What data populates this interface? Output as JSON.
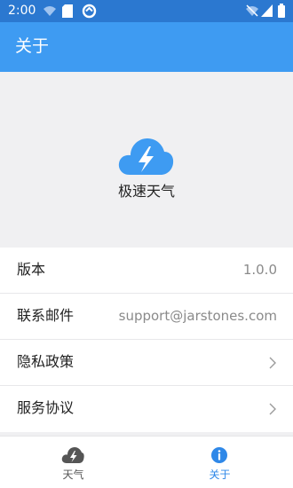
{
  "status_bar": {
    "time": "2:00"
  },
  "app_bar": {
    "title": "关于"
  },
  "about": {
    "app_name": "极速天气"
  },
  "rows": [
    {
      "label": "版本",
      "value": "1.0.0"
    },
    {
      "label": "联系邮件",
      "value": "support@jarstones.com"
    },
    {
      "label": "隐私政策"
    },
    {
      "label": "服务协议"
    }
  ],
  "tabs": [
    {
      "label": "天气",
      "icon": "cloud-bolt-icon",
      "active": false
    },
    {
      "label": "关于",
      "icon": "info-icon",
      "active": true
    }
  ],
  "colors": {
    "status_bar": "#2b78d0",
    "app_bar": "#3e9bf2",
    "logo": "#3e9bf2",
    "active_tab": "#2f88e8"
  }
}
